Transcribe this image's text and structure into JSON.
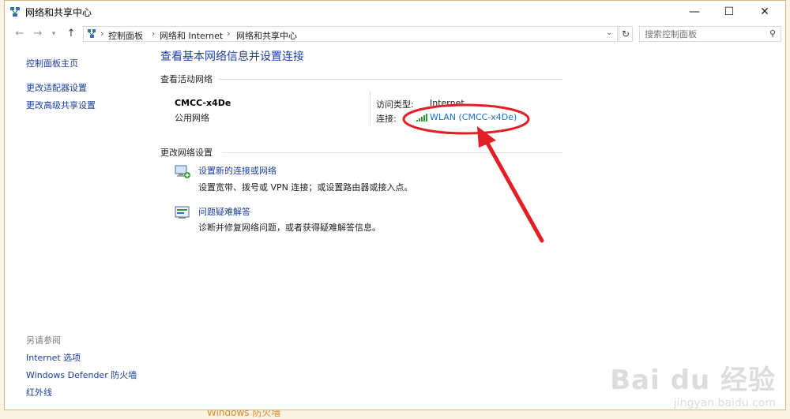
{
  "window": {
    "title": "网络和共享中心",
    "controls": {
      "minimize": "—",
      "maximize": "☐",
      "close": "✕"
    }
  },
  "address_bar": {
    "breadcrumbs": [
      "控制面板",
      "网络和 Internet",
      "网络和共享中心"
    ],
    "search_placeholder": "搜索控制面板"
  },
  "sidebar": {
    "items": [
      {
        "label": "控制面板主页"
      },
      {
        "label": "更改适配器设置"
      },
      {
        "label": "更改高级共享设置"
      }
    ],
    "see_also": {
      "heading": "另请参阅",
      "items": [
        {
          "label": "Internet 选项"
        },
        {
          "label": "Windows Defender 防火墙"
        },
        {
          "label": "红外线"
        }
      ]
    }
  },
  "main": {
    "heading": "查看基本网络信息并设置连接",
    "active_networks": {
      "label": "查看活动网络",
      "network_name": "CMCC-x4De",
      "network_type": "公用网络",
      "access_type_label": "访问类型:",
      "access_type_value": "Internet",
      "connection_label": "连接:",
      "connection_value": "WLAN (CMCC-x4De)"
    },
    "change_settings": {
      "label": "更改网络设置",
      "tasks": [
        {
          "title": "设置新的连接或网络",
          "description": "设置宽带、拨号或 VPN 连接；或设置路由器或接入点。"
        },
        {
          "title": "问题疑难解答",
          "description": "诊断并修复网络问题，或者获得疑难解答信息。"
        }
      ]
    }
  },
  "background": {
    "bottom_text": "Windows 防火墙"
  },
  "watermark": {
    "main": "Bai du 经验",
    "sub": "jingyan.baidu.com"
  },
  "colors": {
    "link": "#1a3e9c",
    "heading": "#1c3fa3",
    "annotation_red": "#e21f26"
  }
}
